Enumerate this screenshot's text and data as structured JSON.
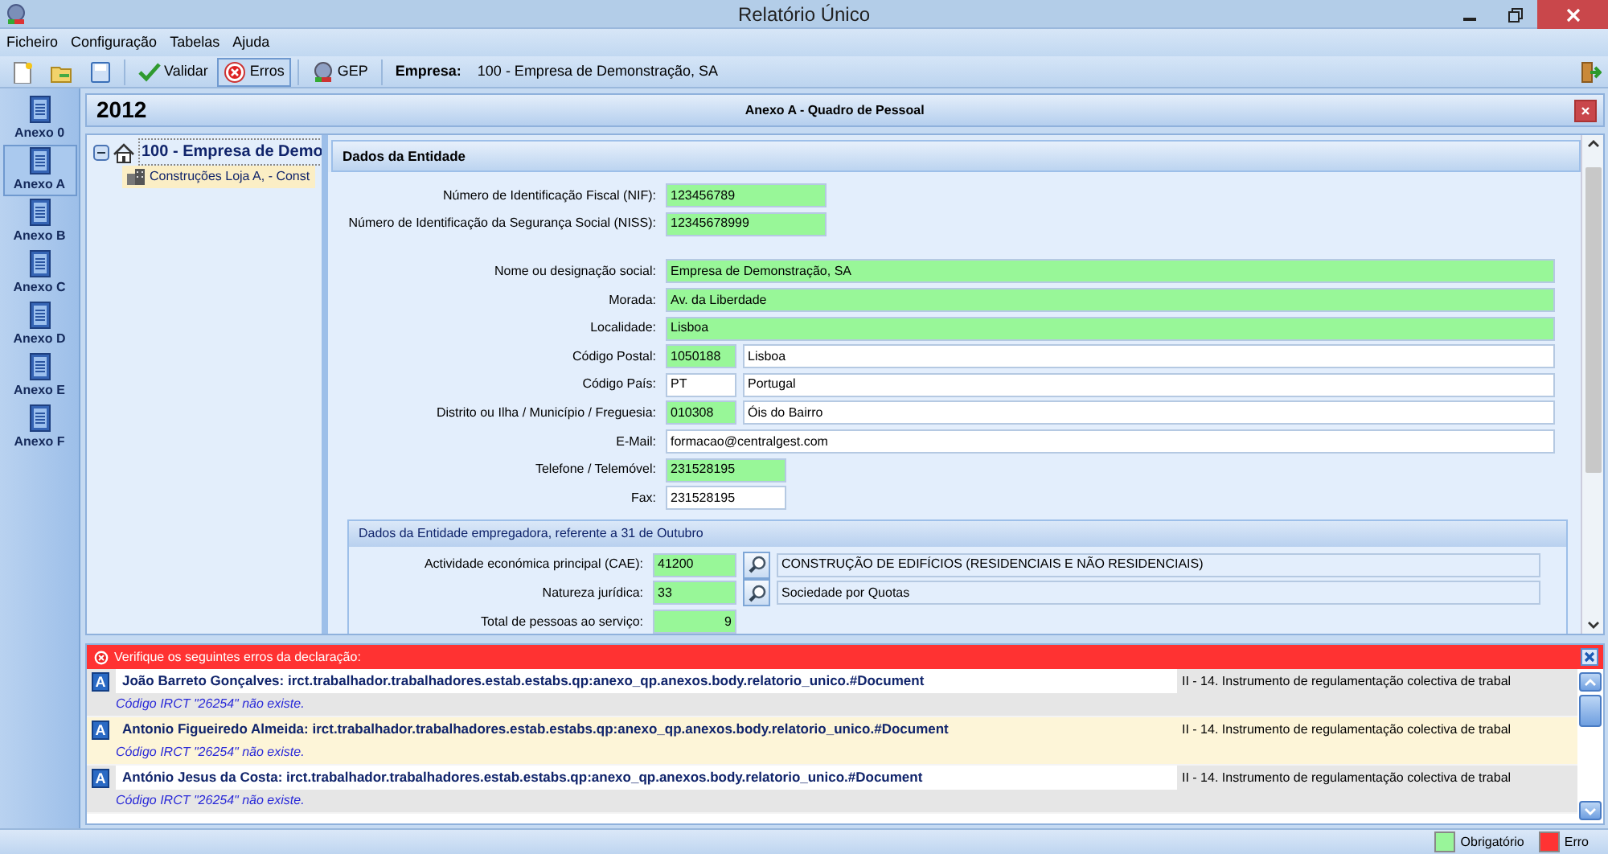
{
  "window": {
    "title": "Relatório Único"
  },
  "menu": [
    {
      "label": "Ficheiro"
    },
    {
      "label": "Configuração"
    },
    {
      "label": "Tabelas"
    },
    {
      "label": "Ajuda"
    }
  ],
  "toolbar": {
    "buttons": [
      {
        "kind": "new",
        "pressed": false
      },
      {
        "kind": "open",
        "pressed": false
      },
      {
        "kind": "save",
        "pressed": false
      },
      {
        "kind": "validate",
        "label": "Validar",
        "pressed": false
      },
      {
        "kind": "errors",
        "label": "Erros",
        "pressed": true
      },
      {
        "kind": "gep",
        "label": "GEP",
        "pressed": false
      }
    ],
    "company_label": "Empresa:",
    "company": "100 - Empresa de Demonstração, SA"
  },
  "sidebar": {
    "items": [
      {
        "label": "Anexo 0",
        "selected": false
      },
      {
        "label": "Anexo A",
        "selected": true
      },
      {
        "label": "Anexo B",
        "selected": false
      },
      {
        "label": "Anexo C",
        "selected": false
      },
      {
        "label": "Anexo D",
        "selected": false
      },
      {
        "label": "Anexo E",
        "selected": false
      },
      {
        "label": "Anexo F",
        "selected": false
      }
    ]
  },
  "document": {
    "year": "2012",
    "title": "Anexo A - Quadro de Pessoal"
  },
  "tree": [
    {
      "label": "100 - Empresa de Demo",
      "expanded": true,
      "selected": false,
      "children": [
        {
          "label": "Construções Loja A, - Const",
          "selected": true
        }
      ]
    }
  ],
  "form": {
    "title": "Dados da Entidade",
    "identification_rows": [
      {
        "label": "Número de Identificação Fiscal (NIF):",
        "fields": [
          {
            "value": "123456789",
            "kind": "id",
            "required": true
          }
        ]
      },
      {
        "label": "Número de Identificação da Segurança Social (NISS):",
        "fields": [
          {
            "value": "12345678999",
            "kind": "id",
            "required": true
          }
        ]
      }
    ],
    "rows": [
      {
        "label": "Nome ou designação social:",
        "fields": [
          {
            "value": "Empresa de Demonstração, SA",
            "kind": "long",
            "required": true
          }
        ]
      },
      {
        "label": "Morada:",
        "fields": [
          {
            "value": "Av. da Liberdade",
            "kind": "long",
            "required": true
          }
        ]
      },
      {
        "label": "Localidade:",
        "fields": [
          {
            "value": "Lisboa",
            "kind": "long",
            "required": true
          }
        ]
      },
      {
        "label": "Código Postal:",
        "fields": [
          {
            "value": "1050188",
            "kind": "short",
            "required": true
          },
          {
            "value": "Lisboa",
            "kind": "long",
            "required": false
          }
        ]
      },
      {
        "label": "Código País:",
        "fields": [
          {
            "value": "PT",
            "kind": "short",
            "required": false
          },
          {
            "value": "Portugal",
            "kind": "long",
            "required": false
          }
        ]
      },
      {
        "label": "Distrito ou Ilha / Município / Freguesia:",
        "fields": [
          {
            "value": "010308",
            "kind": "short",
            "required": true
          },
          {
            "value": "Óis do Bairro",
            "kind": "long",
            "required": false
          }
        ]
      },
      {
        "label": "E-Mail:",
        "fields": [
          {
            "value": "formacao@centralgest.com",
            "kind": "long",
            "required": false
          }
        ]
      },
      {
        "label": "Telefone / Telemóvel:",
        "fields": [
          {
            "value": "231528195",
            "kind": "phone",
            "required": true
          }
        ]
      },
      {
        "label": "Fax:",
        "fields": [
          {
            "value": "231528195",
            "kind": "phone",
            "required": false
          }
        ]
      }
    ],
    "group": {
      "title": "Dados da Entidade empregadora, referente a 31 de Outubro",
      "rows": [
        {
          "label": "Actividade económica principal (CAE):",
          "fields": [
            {
              "value": "41200",
              "kind": "code",
              "required": true
            },
            {
              "kind": "lookup"
            },
            {
              "value": "CONSTRUÇÃO DE EDIFÍCIOS (RESIDENCIAIS E NÃO RESIDENCIAIS)",
              "kind": "description"
            }
          ]
        },
        {
          "label": "Natureza jurídica:",
          "fields": [
            {
              "value": "33",
              "kind": "code",
              "required": true
            },
            {
              "kind": "lookup"
            },
            {
              "value": "Sociedade por Quotas",
              "kind": "description"
            }
          ]
        },
        {
          "label": "Total de pessoas ao serviço:",
          "fields": [
            {
              "value": "9",
              "kind": "count",
              "required": true
            }
          ]
        }
      ]
    }
  },
  "errors": {
    "title": "Verifique os seguintes erros da declaração:",
    "rows": [
      {
        "badge": "A",
        "source": "João Barreto Gonçalves: irct.trabalhador.trabalhadores.estab.estabs.qp:anexo_qp.anexos.body.relatorio_unico.#Document",
        "section": "II - 14. Instrumento de regulamentação colectiva de trabal",
        "message": "Código IRCT \"26254\" não existe.",
        "selected": false
      },
      {
        "badge": "A",
        "source": "Antonio Figueiredo Almeida: irct.trabalhador.trabalhadores.estab.estabs.qp:anexo_qp.anexos.body.relatorio_unico.#Document",
        "section": "II - 14. Instrumento de regulamentação colectiva de trabal",
        "message": "Código IRCT \"26254\" não existe.",
        "selected": true
      },
      {
        "badge": "A",
        "source": "António Jesus da Costa: irct.trabalhador.trabalhadores.estab.estabs.qp:anexo_qp.anexos.body.relatorio_unico.#Document",
        "section": "II - 14. Instrumento de regulamentação colectiva de trabal",
        "message": "Código IRCT \"26254\" não existe.",
        "selected": false
      }
    ]
  },
  "legend": [
    {
      "label": "Obrigatório",
      "color": "#99f59a"
    },
    {
      "label": "Erro",
      "color": "#ff3333"
    }
  ]
}
